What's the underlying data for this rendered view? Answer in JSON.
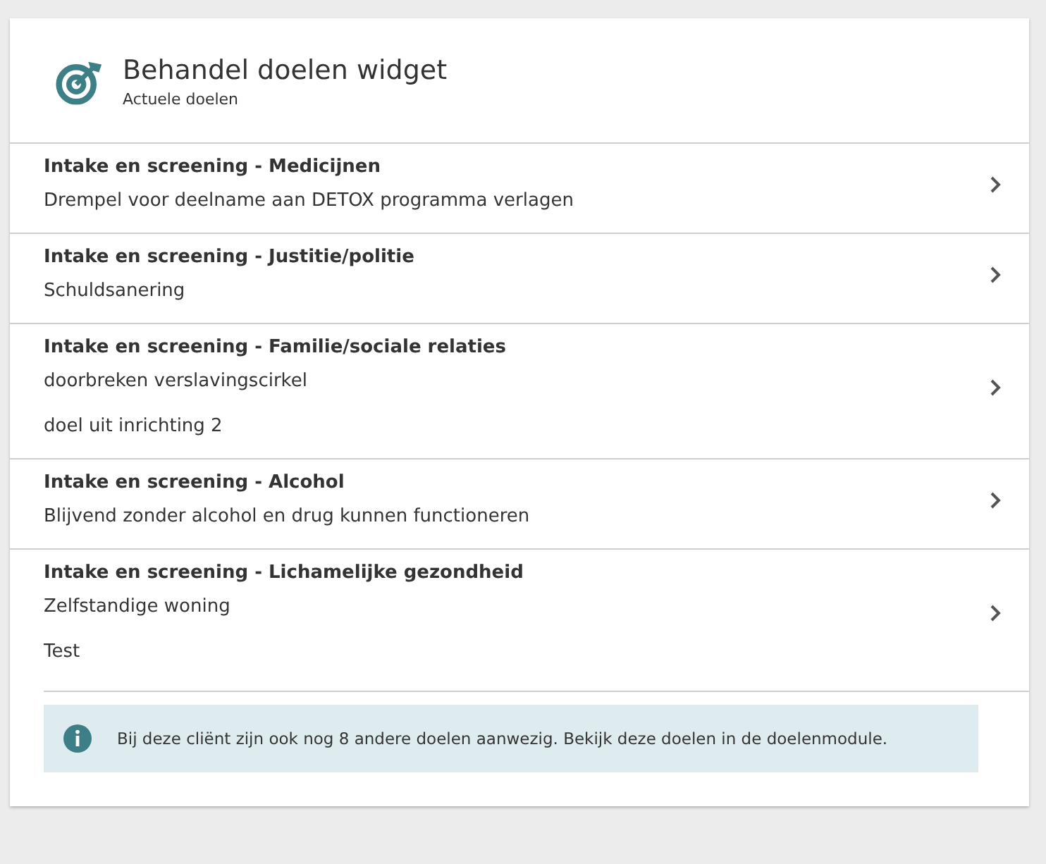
{
  "widget": {
    "title": "Behandel doelen widget",
    "subtitle": "Actuele doelen"
  },
  "groups": [
    {
      "heading": "Intake en screening - Medicijnen",
      "goals": [
        "Drempel voor deelname aan DETOX programma verlagen"
      ]
    },
    {
      "heading": "Intake en screening - Justitie/politie",
      "goals": [
        "Schuldsanering"
      ]
    },
    {
      "heading": "Intake en screening - Familie/sociale relaties",
      "goals": [
        "doorbreken verslavingscirkel",
        "doel uit inrichting 2"
      ]
    },
    {
      "heading": "Intake en screening - Alcohol",
      "goals": [
        "Blijvend zonder alcohol en drug kunnen functioneren"
      ]
    },
    {
      "heading": "Intake en screening - Lichamelijke gezondheid",
      "goals": [
        "Zelfstandige woning",
        "Test"
      ]
    }
  ],
  "notice": "Bij deze cliënt zijn ook nog 8 andere doelen aanwezig. Bekijk deze doelen in de doelenmodule."
}
